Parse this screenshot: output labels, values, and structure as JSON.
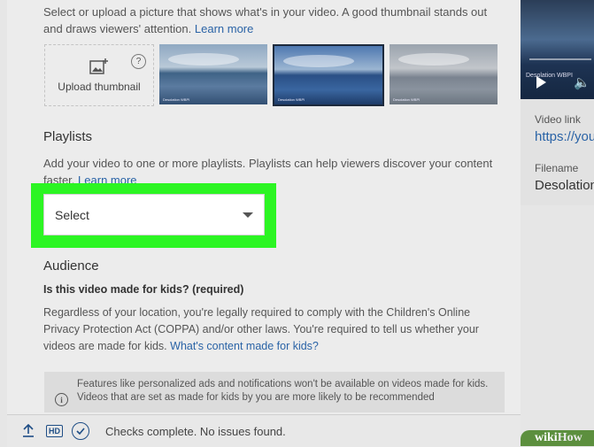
{
  "thumbnail_section": {
    "description": "Select or upload a picture that shows what's in your video. A good thumbnail stands out and draws viewers' attention.",
    "learn_more": "Learn more",
    "upload_label": "Upload thumbnail",
    "help_symbol": "?",
    "thumbnails": [
      {
        "caption": "Desolation WBPI"
      },
      {
        "caption": "Desolation WBPI"
      },
      {
        "caption": "Desolation WBPI"
      }
    ]
  },
  "playlists": {
    "title": "Playlists",
    "description": "Add your video to one or more playlists. Playlists can help viewers discover your content faster.",
    "learn_more": "Learn more",
    "select_label": "Select"
  },
  "audience": {
    "title": "Audience",
    "question": "Is this video made for kids? (required)",
    "description": "Regardless of your location, you're legally required to comply with the Children's Online Privacy Protection Act (COPPA) and/or other laws. You're required to tell us whether your videos are made for kids.",
    "content_link": "What's content made for kids?",
    "notice": "Features like personalized ads and notifications won't be available on videos made for kids. Videos that are set as made for kids by you are more likely to be recommended"
  },
  "footer": {
    "hd_label": "HD",
    "status": "Checks complete. No issues found."
  },
  "side_panel": {
    "preview_caption": "Desolation WBPI",
    "video_link_label": "Video link",
    "video_link_value": "https://you",
    "filename_label": "Filename",
    "filename_value": "Desolation"
  },
  "watermark": {
    "wiki": "wiki",
    "how": "How"
  },
  "colors": {
    "highlight": "#2cf523",
    "link": "#2a63a6",
    "status_icon": "#1f4e86"
  }
}
